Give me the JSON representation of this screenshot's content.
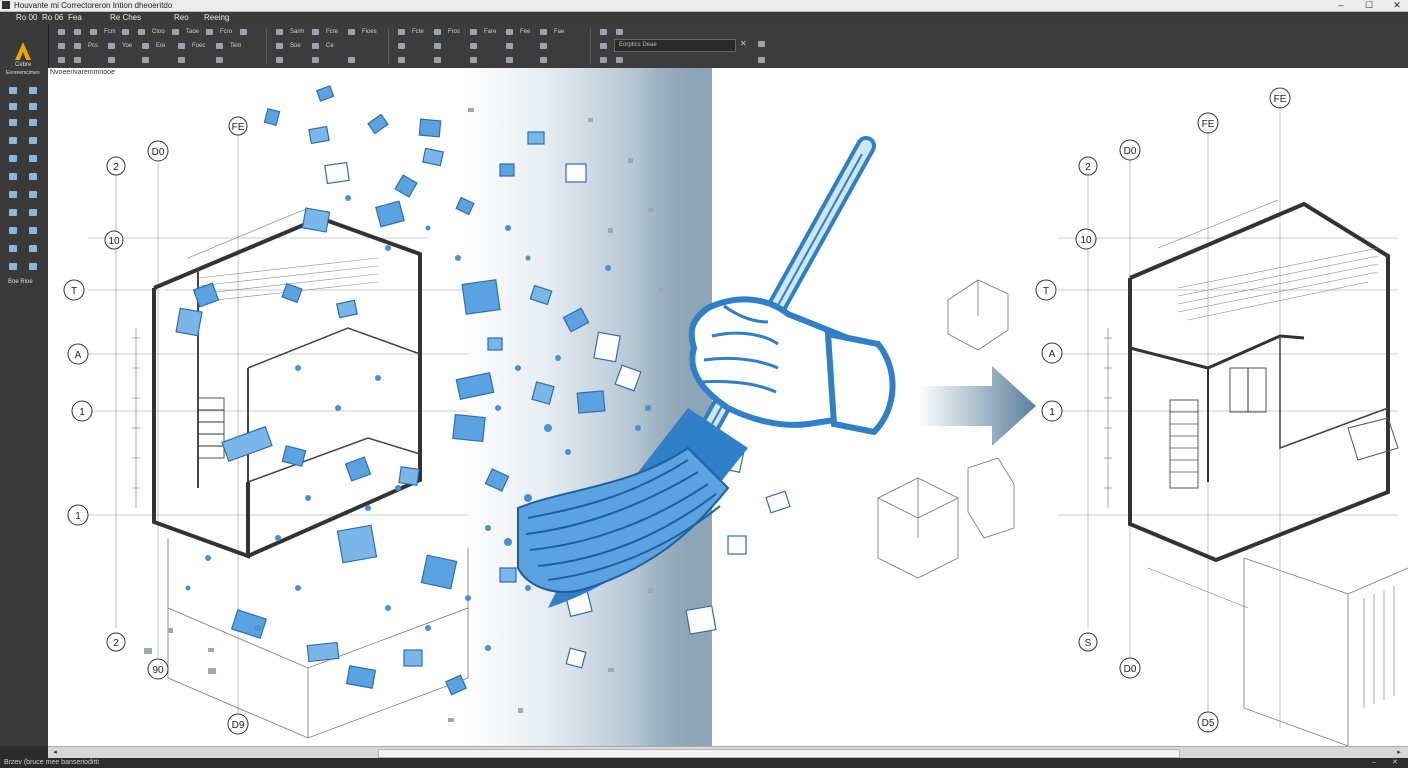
{
  "window": {
    "title": "Houvante mi Correctoreron Intion dheoeritdo",
    "minimize": "–",
    "maximize": "☐",
    "close": "✕"
  },
  "menu": {
    "items": [
      "Ro 00",
      "Ro 06",
      "Fea",
      "Re Ches",
      "Reo",
      "Reeing"
    ]
  },
  "toolbar": {
    "row1_labels": [
      "Fcm",
      "Ctoo",
      "Taoe",
      "Fcro",
      "Sarm",
      "Fcre",
      "Fioes",
      "Fcte",
      "Fros",
      "Fare",
      "Fee",
      "Fae"
    ],
    "row2_labels": [
      "Pcs",
      "Yoe",
      "Ere",
      "Foec",
      "Tem",
      "Soe",
      "Ce"
    ],
    "command_placeholder": "Eorptics Deae",
    "command_close": "✕"
  },
  "left_toolbar": {
    "logo_caption": "Cebre",
    "logo_sub": "Eeoreemcimeo",
    "bottom_label": "Boe Rioe"
  },
  "viewport": {
    "label": "Nvoeerivaremmnooe"
  },
  "drawing": {
    "grid_bubbles_left": [
      "2",
      "10",
      "T",
      "A",
      "1",
      "1",
      "2"
    ],
    "grid_bubbles_top_left": [
      "FE",
      "D0"
    ],
    "grid_bubbles_bottom_left": [
      "90",
      "D9"
    ],
    "grid_bubbles_right": [
      "2",
      "10",
      "T",
      "A",
      "1",
      "S"
    ],
    "grid_bubbles_top_right": [
      "FE",
      "FE",
      "D0"
    ],
    "grid_bubbles_bottom_right": [
      "D0",
      "D5"
    ],
    "arrow_color": "#5a7f9c",
    "tool_color": "#2f7fc9",
    "fragment_color": "#4a90d4"
  },
  "scrollbar": {
    "left_arrow": "◂",
    "right_arrow": "▸"
  },
  "status": {
    "text": "Brzev (bruce mee banserioditti",
    "ctl_a": "–",
    "ctl_b": "✕"
  }
}
